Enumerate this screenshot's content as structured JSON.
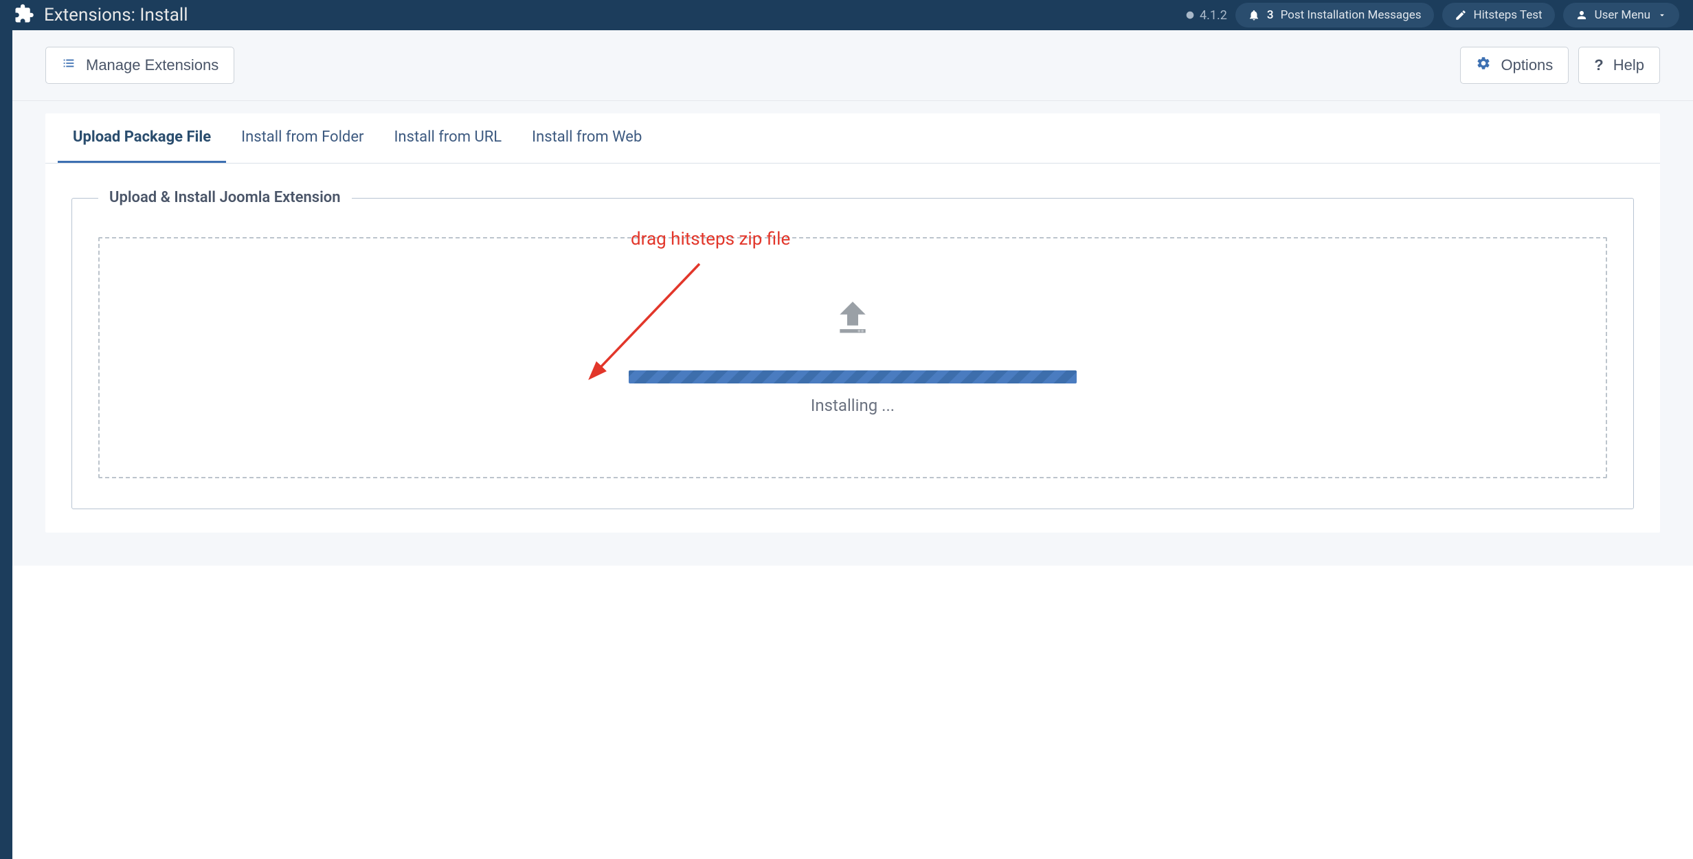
{
  "header": {
    "title": "Extensions: Install",
    "version": "4.1.2",
    "notifications_count": "3",
    "notifications_label": "Post Installation Messages",
    "hitsteps_label": "Hitsteps Test",
    "usermenu_label": "User Menu"
  },
  "toolbar": {
    "manage_label": "Manage Extensions",
    "options_label": "Options",
    "help_label": "Help"
  },
  "tabs": [
    {
      "label": "Upload Package File",
      "active": true
    },
    {
      "label": "Install from Folder",
      "active": false
    },
    {
      "label": "Install from URL",
      "active": false
    },
    {
      "label": "Install from Web",
      "active": false
    }
  ],
  "annotation": {
    "text": "drag hitsteps zip file"
  },
  "upload": {
    "legend": "Upload & Install Joomla Extension",
    "status": "Installing ..."
  }
}
